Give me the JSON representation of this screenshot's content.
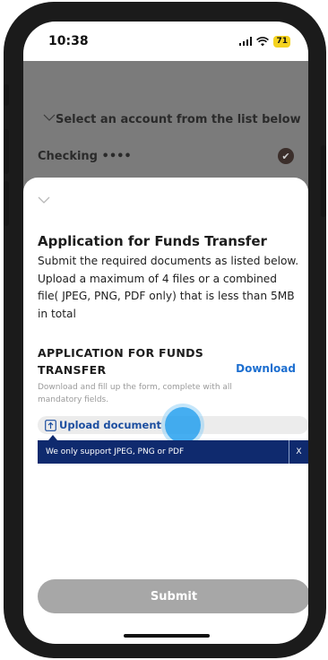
{
  "status_bar": {
    "time": "10:38",
    "battery": "71",
    "battery_color": "#f4d21f"
  },
  "background_screen": {
    "prompt": "Select an account from the list below",
    "account": "Checking ••••"
  },
  "sheet": {
    "title": "Application for Funds Transfer",
    "description": "Submit the required documents as listed below. Upload a maximum of 4 files or a combined file( JPEG, PNG, PDF only) that is less than 5MB in total"
  },
  "document_card": {
    "title": "APPLICATION FOR FUNDS TRANSFER",
    "subtitle": "Download and fill up the form, complete with all mandatory fields.",
    "download_label": "Download",
    "upload_label": "Upload document"
  },
  "tooltip": {
    "message": "We only support JPEG, PNG or PDF",
    "close_label": "X"
  },
  "submit_label": "Submit",
  "colors": {
    "accent_link": "#1d6fd0",
    "tooltip_bg": "#0f2a6e",
    "submit_disabled": "#a7a7a7"
  },
  "icons": [
    "chevron-down-icon",
    "check-circle-icon",
    "upload-icon",
    "signal-icon",
    "wifi-icon",
    "battery-icon"
  ]
}
